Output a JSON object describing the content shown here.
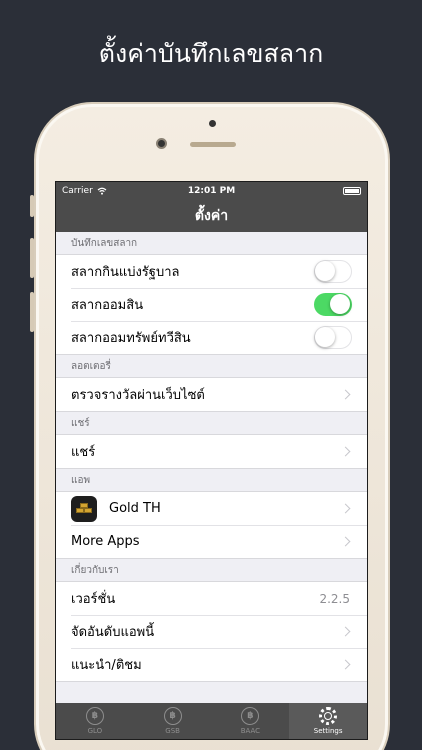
{
  "headline": "ตั้งค่าบันทึกเลขสลาก",
  "status_bar": {
    "carrier": "Carrier",
    "time": "12:01 PM"
  },
  "nav": {
    "title": "ตั้งค่า"
  },
  "sections": {
    "record": {
      "header": "บันทึกเลขสลาก",
      "rows": [
        {
          "label": "สลากกินแบ่งรัฐบาล",
          "on": false
        },
        {
          "label": "สลากออมสิน",
          "on": true
        },
        {
          "label": "สลากออมทรัพย์ทวีสิน",
          "on": false
        }
      ]
    },
    "lottery": {
      "header": "ลอตเตอรี่",
      "rows": [
        {
          "label": "ตรวจรางวัลผ่านเว็บไซต์"
        }
      ]
    },
    "share": {
      "header": "แชร์",
      "rows": [
        {
          "label": "แชร์"
        }
      ]
    },
    "apps": {
      "header": "แอพ",
      "rows": [
        {
          "label": "Gold TH"
        },
        {
          "label": "More Apps"
        }
      ]
    },
    "about": {
      "header": "เกี่ยวกับเรา",
      "rows": [
        {
          "label": "เวอร์ชั่น",
          "value": "2.2.5"
        },
        {
          "label": "จัดอันดับแอพนี้"
        },
        {
          "label": "แนะนำ/ติชม"
        }
      ]
    }
  },
  "tabs": [
    {
      "label": "GLO",
      "glyph": "฿",
      "active": false
    },
    {
      "label": "GSB",
      "glyph": "฿",
      "active": false
    },
    {
      "label": "BAAC",
      "glyph": "฿",
      "active": false
    },
    {
      "label": "Settings",
      "active": true
    }
  ],
  "colors": {
    "toggle_on": "#4cd964",
    "bar": "#4b4b4b",
    "background": "#2b2f38"
  },
  "icons": {
    "wifi": "wifi-icon",
    "battery": "battery-icon",
    "chevron": "chevron-right-icon",
    "app": "gold-bars-icon",
    "settings": "gear-icon"
  }
}
